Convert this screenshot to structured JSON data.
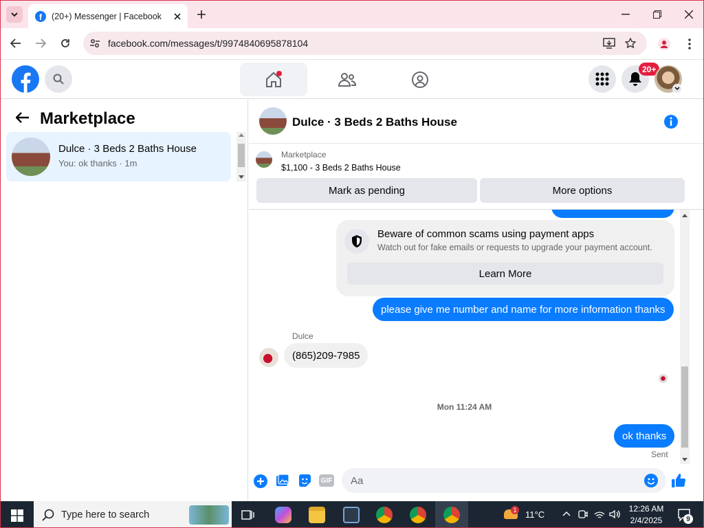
{
  "browser": {
    "tab_title": "(20+) Messenger | Facebook",
    "url": "facebook.com/messages/t/9974840695878104"
  },
  "fb_header": {
    "notification_badge": "20+"
  },
  "sidebar": {
    "title": "Marketplace",
    "conversation": {
      "name": "Dulce · 3 Beds 2 Baths House",
      "preview": "You: ok thanks · 1m"
    }
  },
  "chat": {
    "header_title": "Dulce · 3 Beds 2 Baths House",
    "marketplace_label": "Marketplace",
    "listing": "$1,100 - 3 Beds 2 Baths House",
    "mark_pending": "Mark as pending",
    "more_options": "More options",
    "scam": {
      "title": "Beware of common scams using payment apps",
      "body": "Watch out for fake emails or requests to upgrade your payment account.",
      "button": "Learn More"
    },
    "msg_out_1": "please give me number and name for more information thanks",
    "sender_name": "Dulce",
    "msg_in_1": "(865)209-7985",
    "timestamp": "Mon 11:24 AM",
    "msg_out_2": "ok thanks",
    "status": "Sent",
    "composer_placeholder": "Aa"
  },
  "taskbar": {
    "search_placeholder": "Type here to search",
    "weather": "11°C",
    "weather_badge": "1",
    "time": "12:26 AM",
    "date": "2/4/2025",
    "notif_count": "9"
  },
  "colors": {
    "brand": "#1877f2",
    "bubble": "#0a7cff",
    "badge": "#e41e3f"
  }
}
